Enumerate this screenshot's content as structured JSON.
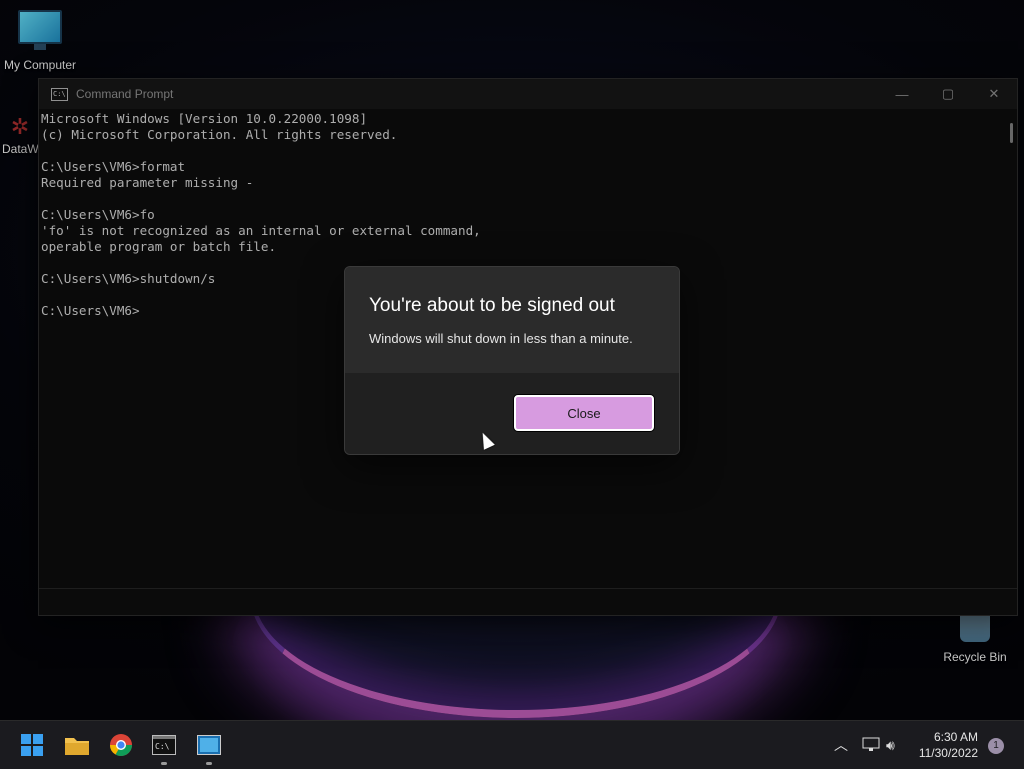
{
  "desktop": {
    "icons": [
      {
        "label": "My Computer"
      },
      {
        "label": "DataW"
      },
      {
        "label": "Recycle Bin"
      }
    ]
  },
  "cmd_window": {
    "title": "Command Prompt",
    "lines": [
      "Microsoft Windows [Version 10.0.22000.1098]",
      "(c) Microsoft Corporation. All rights reserved.",
      "",
      "C:\\Users\\VM6>format",
      "Required parameter missing -",
      "",
      "C:\\Users\\VM6>fo",
      "'fo' is not recognized as an internal or external command,",
      "operable program or batch file.",
      "",
      "C:\\Users\\VM6>shutdown/s",
      "",
      "C:\\Users\\VM6>"
    ]
  },
  "dialog": {
    "title": "You're about to be signed out",
    "message": "Windows will shut down in less than a minute.",
    "close_label": "Close",
    "close_color": "#d79be0"
  },
  "taskbar": {
    "apps": [
      "start-icon",
      "file-explorer-icon",
      "chrome-icon",
      "terminal-icon",
      "app-window-icon"
    ],
    "time": "6:30 AM",
    "date": "11/30/2022",
    "notification_count": "1"
  }
}
